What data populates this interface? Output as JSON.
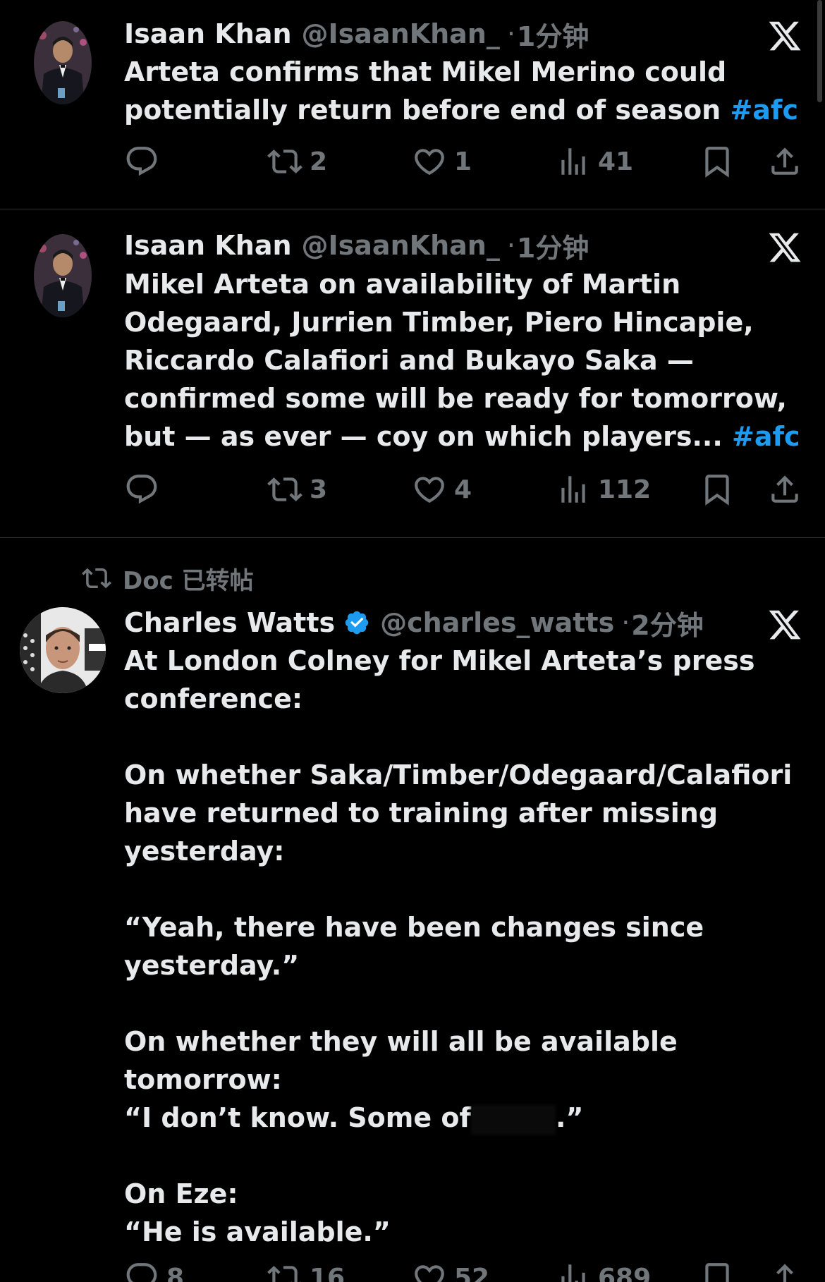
{
  "tweets": [
    {
      "name": "Isaan Khan",
      "handle": "@IsaanKhan_",
      "dot": "·",
      "time": "1分钟",
      "text": "Arteta confirms that Mikel Merino could potentially return before end of season ",
      "hashtag": "#afc",
      "replies": "",
      "retweets": "2",
      "likes": "1",
      "views": "41"
    },
    {
      "name": "Isaan Khan",
      "handle": "@IsaanKhan_",
      "dot": "·",
      "time": "1分钟",
      "text": "Mikel Arteta on availability of Martin Odegaard, Jurrien Timber, Piero Hincapie, Riccardo Calafiori and Bukayo Saka — confirmed some will be ready for tomorrow, but — as ever — coy on which players... ",
      "hashtag": "#afc",
      "replies": "",
      "retweets": "3",
      "likes": "4",
      "views": "112"
    },
    {
      "retweet_context": "Doc 已转帖",
      "name": "Charles Watts",
      "handle": "@charles_watts",
      "dot": "·",
      "time": "2分钟",
      "text_part1": "At London Colney for Mikel Arteta’s press conference:\n\nOn whether Saka/Timber/Odegaard/Calafiori have returned to training after missing yesterday:\n\n“Yeah, there have been changes since yesterday.”\n\nOn whether they will all be available tomorrow:\n“I don’t know. Some of",
      "text_part2": ".”\n\nOn Eze:\n“He is available.”",
      "replies": "8",
      "retweets": "16",
      "likes": "52",
      "views": "689"
    }
  ],
  "colors": {
    "background": "#000000",
    "text": "#e7e9ea",
    "muted": "#71767b",
    "link": "#1d9bf0",
    "verified": "#1d9bf0",
    "divider": "#2f3336"
  },
  "icons": {
    "reply": "reply-icon",
    "retweet": "retweet-icon",
    "like": "heart-icon",
    "views": "views-icon",
    "bookmark": "bookmark-icon",
    "share": "share-icon",
    "brand": "x-logo-icon"
  }
}
